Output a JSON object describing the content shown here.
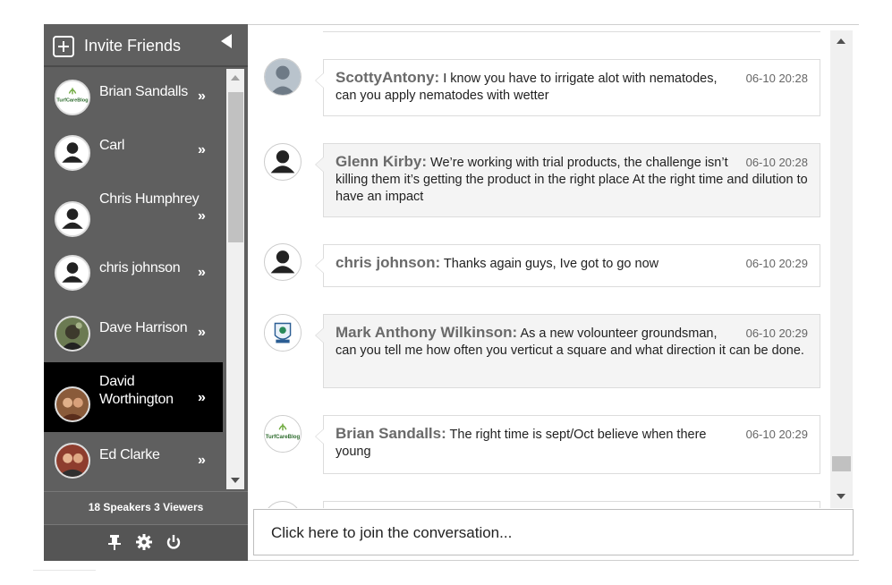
{
  "sidebar": {
    "invite_label": "Invite Friends",
    "users": [
      {
        "name": "Brian Sandalls",
        "avatar": "turfcareblog-logo",
        "active": false
      },
      {
        "name": "Carl",
        "avatar": "default-person",
        "active": false
      },
      {
        "name": "Chris Humphrey",
        "avatar": "default-person",
        "active": false
      },
      {
        "name": "chris johnson",
        "avatar": "default-person",
        "active": false
      },
      {
        "name": "Dave Harrison",
        "avatar": "photo",
        "active": false
      },
      {
        "name": "David Worthington",
        "avatar": "photo",
        "active": true
      },
      {
        "name": "Ed Clarke",
        "avatar": "photo",
        "active": false
      }
    ],
    "chevron": "»",
    "speakers_count": "18",
    "speakers_label": "Speakers",
    "viewers_count": "3",
    "viewers_label": "Viewers",
    "tools": [
      "pin-icon",
      "gear-icon",
      "power-icon"
    ]
  },
  "messages": [
    {
      "author": "ScottyAntony:",
      "text": "I know you have to irrigate alot with nematodes, can you apply nematodes with wetter",
      "time": "06-10 20:28",
      "avatar": "grey-person"
    },
    {
      "author": "Glenn Kirby:",
      "text": "We’re working with trial products, the challenge isn’t killing them it’s getting the product in the right place At the right time and dilution to have an impact",
      "time": "06-10 20:28",
      "avatar": "default-person"
    },
    {
      "author": "chris johnson:",
      "text": "Thanks again guys, Ive got to go now",
      "time": "06-10 20:29",
      "avatar": "default-person"
    },
    {
      "author": "Mark Anthony Wilkinson:",
      "text": "As a new volounteer groundsman, can you tell me how often you verticut a square and what direction it can be done.",
      "time": "06-10 20:29",
      "avatar": "club-crest"
    },
    {
      "author": "Brian Sandalls:",
      "text": "The right time is sept/Oct believe when there young",
      "time": "06-10 20:29",
      "avatar": "turfcareblog-logo"
    }
  ],
  "composer": {
    "placeholder": "Click here to join the conversation..."
  },
  "logo_text": "TurfCareBlog",
  "colors": {
    "sidebar": "#5f5f5f",
    "active_user": "#000000",
    "author": "#6a6a6a",
    "bubble_grey": "#f4f4f4"
  }
}
